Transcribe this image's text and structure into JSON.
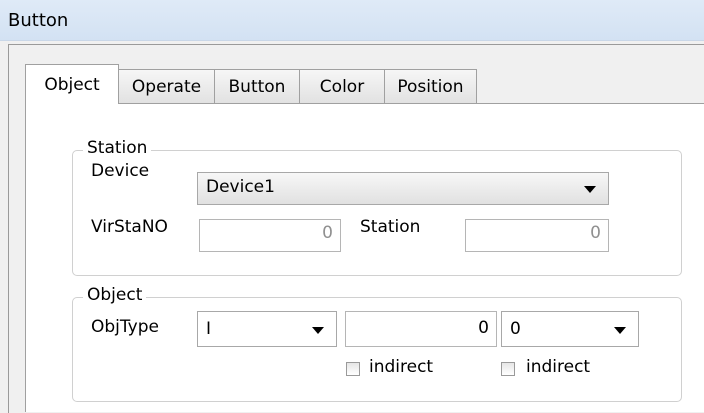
{
  "window": {
    "title": "Button"
  },
  "tabs": [
    {
      "label": "Object",
      "active": true
    },
    {
      "label": "Operate",
      "active": false
    },
    {
      "label": "Button",
      "active": false
    },
    {
      "label": "Color",
      "active": false
    },
    {
      "label": "Position",
      "active": false
    }
  ],
  "station_group": {
    "legend": "Station",
    "device_label": "Device",
    "device_value": "Device1",
    "virstano_label": "VirStaNO",
    "virstano_value": "0",
    "station_label": "Station",
    "station_value": "0"
  },
  "object_group": {
    "legend": "Object",
    "objtype_label": "ObjType",
    "objtype_value": "I",
    "address_value": "0",
    "second_value": "0",
    "indirect_label_1": "indirect",
    "indirect_label_2": "indirect"
  }
}
